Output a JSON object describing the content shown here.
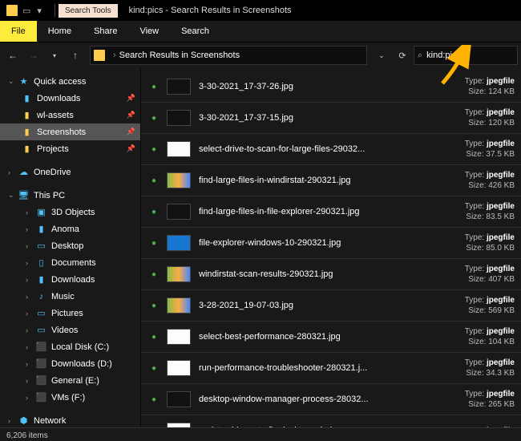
{
  "window": {
    "title": "kind:pics - Search Results in Screenshots",
    "search_tools_label": "Search Tools"
  },
  "ribbon": {
    "file": "File",
    "home": "Home",
    "share": "Share",
    "view": "View",
    "search": "Search"
  },
  "navbar": {
    "breadcrumb": "Search Results in Screenshots",
    "search_value": "kind:pics"
  },
  "tree": {
    "quick_access": "Quick access",
    "downloads": "Downloads",
    "wlassets": "wl-assets",
    "screenshots": "Screenshots",
    "projects": "Projects",
    "onedrive": "OneDrive",
    "this_pc": "This PC",
    "threed": "3D Objects",
    "anoma": "Anoma",
    "desktop": "Desktop",
    "documents": "Documents",
    "downloads2": "Downloads",
    "music": "Music",
    "pictures": "Pictures",
    "videos": "Videos",
    "local_c": "Local Disk (C:)",
    "down_d": "Downloads (D:)",
    "gen_e": "General (E:)",
    "vms_f": "VMs (F:)",
    "network": "Network"
  },
  "type_label": "Type:",
  "type_value": "jpegfile",
  "size_label": "Size:",
  "files": [
    {
      "name": "3-30-2021_17-37-26.jpg",
      "size": "124 KB",
      "thumb": "dark"
    },
    {
      "name": "3-30-2021_17-37-15.jpg",
      "size": "120 KB",
      "thumb": "dark"
    },
    {
      "name": "select-drive-to-scan-for-large-files-29032...",
      "size": "37.5 KB",
      "thumb": "white"
    },
    {
      "name": "find-large-files-in-windirstat-290321.jpg",
      "size": "426 KB",
      "thumb": "mix"
    },
    {
      "name": "find-large-files-in-file-explorer-290321.jpg",
      "size": "83.5 KB",
      "thumb": "dark"
    },
    {
      "name": "file-explorer-windows-10-290321.jpg",
      "size": "85.0 KB",
      "thumb": "blue"
    },
    {
      "name": "windirstat-scan-results-290321.jpg",
      "size": "407 KB",
      "thumb": "mix"
    },
    {
      "name": "3-28-2021_19-07-03.jpg",
      "size": "569 KB",
      "thumb": "mix"
    },
    {
      "name": "select-best-performance-280321.jpg",
      "size": "104 KB",
      "thumb": "white"
    },
    {
      "name": "run-performance-troubleshooter-280321.j...",
      "size": "34.3 KB",
      "thumb": "white"
    },
    {
      "name": "desktop-window-manager-process-28032...",
      "size": "265 KB",
      "thumb": "dark"
    },
    {
      "name": "update-drivers-to-fix-desktop-window-m...",
      "size": "",
      "thumb": "white"
    }
  ],
  "status": {
    "items": "6,206 items"
  }
}
